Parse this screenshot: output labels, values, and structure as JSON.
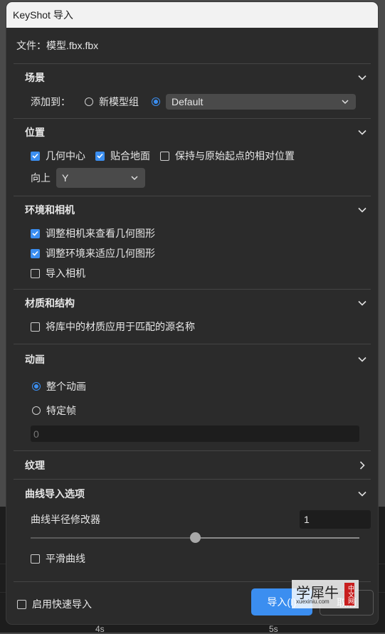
{
  "window": {
    "title": "KeyShot 导入"
  },
  "file": {
    "label": "文件：模型.fbx.fbx"
  },
  "scene": {
    "title": "场景",
    "add_to_label": "添加到：",
    "new_group_label": "新模型组",
    "group_select_value": "Default"
  },
  "position": {
    "title": "位置",
    "geometry_center": "几何中心",
    "snap_ground": "贴合地面",
    "keep_origin": "保持与原始起点的相对位置",
    "up_label": "向上",
    "up_value": "Y"
  },
  "environment": {
    "title": "环境和相机",
    "adjust_camera": "调整相机来查看几何图形",
    "adjust_env": "调整环境来适应几何图形",
    "import_camera": "导入相机"
  },
  "materials": {
    "title": "材质和结构",
    "apply_library": "将库中的材质应用于匹配的源名称"
  },
  "animation": {
    "title": "动画",
    "whole": "整个动画",
    "specific": "特定帧",
    "frame_placeholder": "0"
  },
  "texture": {
    "title": "纹理"
  },
  "curves": {
    "title": "曲线导入选项",
    "radius_label": "曲线半径修改器",
    "radius_value": "1",
    "slider_fraction": 0.5,
    "smooth": "平滑曲线"
  },
  "footer": {
    "fast_import": "启用快速导入",
    "import_button": "导入(I)",
    "cancel_button": "取消"
  },
  "background": {
    "tick_4s": "4s",
    "tick_5s": "5s"
  },
  "watermark": {
    "text": "学犀牛",
    "sub": "xuexiniu.com",
    "badge": "中文网"
  },
  "colors": {
    "accent": "#3b8ef0",
    "dialog_bg": "#2b2b2b",
    "title_bg": "#f2f2f2"
  }
}
